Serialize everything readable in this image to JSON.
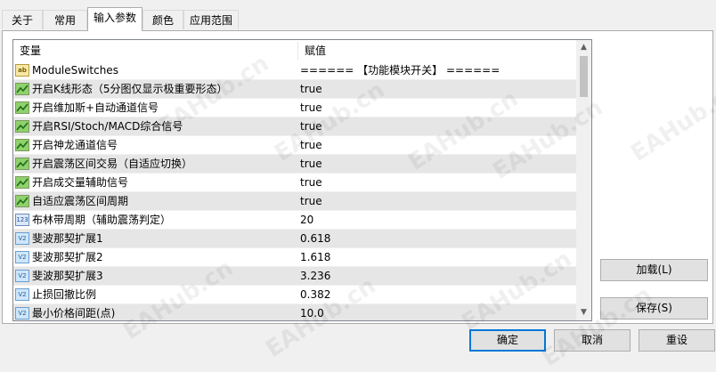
{
  "tabs": [
    {
      "label": "关于",
      "active": false
    },
    {
      "label": "常用",
      "active": false
    },
    {
      "label": "输入参数",
      "active": true
    },
    {
      "label": "颜色",
      "active": false
    },
    {
      "label": "应用范围",
      "active": false
    }
  ],
  "grid": {
    "col_variable": "变量",
    "col_value": "赋值",
    "rows": [
      {
        "type": "string",
        "icon": "ab",
        "name": "ModuleSwitches",
        "value": "====== 【功能模块开关】 ======"
      },
      {
        "type": "bool",
        "icon": "",
        "name": "开启K线形态（5分图仅显示极重要形态）",
        "value": "true"
      },
      {
        "type": "bool",
        "icon": "",
        "name": "开启维加斯+自动通道信号",
        "value": "true"
      },
      {
        "type": "bool",
        "icon": "",
        "name": "开启RSI/Stoch/MACD综合信号",
        "value": "true"
      },
      {
        "type": "bool",
        "icon": "",
        "name": "开启神龙通道信号",
        "value": "true"
      },
      {
        "type": "bool",
        "icon": "",
        "name": "开启震荡区间交易（自适应切换）",
        "value": "true"
      },
      {
        "type": "bool",
        "icon": "",
        "name": "开启成交量辅助信号",
        "value": "true"
      },
      {
        "type": "bool",
        "icon": "",
        "name": "自适应震荡区间周期",
        "value": "true"
      },
      {
        "type": "int",
        "icon": "123",
        "name": "布林带周期（辅助震荡判定）",
        "value": "20"
      },
      {
        "type": "double",
        "icon": "V2",
        "name": "斐波那契扩展1",
        "value": "0.618"
      },
      {
        "type": "double",
        "icon": "V2",
        "name": "斐波那契扩展2",
        "value": "1.618"
      },
      {
        "type": "double",
        "icon": "V2",
        "name": "斐波那契扩展3",
        "value": "3.236"
      },
      {
        "type": "double",
        "icon": "V2",
        "name": "止损回撤比例",
        "value": "0.382"
      },
      {
        "type": "double",
        "icon": "V2",
        "name": "最小价格间距(点)",
        "value": "10.0"
      }
    ]
  },
  "buttons": {
    "load": "加载(L)",
    "save": "保存(S)",
    "ok": "确定",
    "cancel": "取消",
    "reset": "重设"
  },
  "watermark": "EAHub.cn",
  "icons": {
    "scroll_up": "chevron-up-icon",
    "scroll_down": "chevron-down-icon"
  }
}
